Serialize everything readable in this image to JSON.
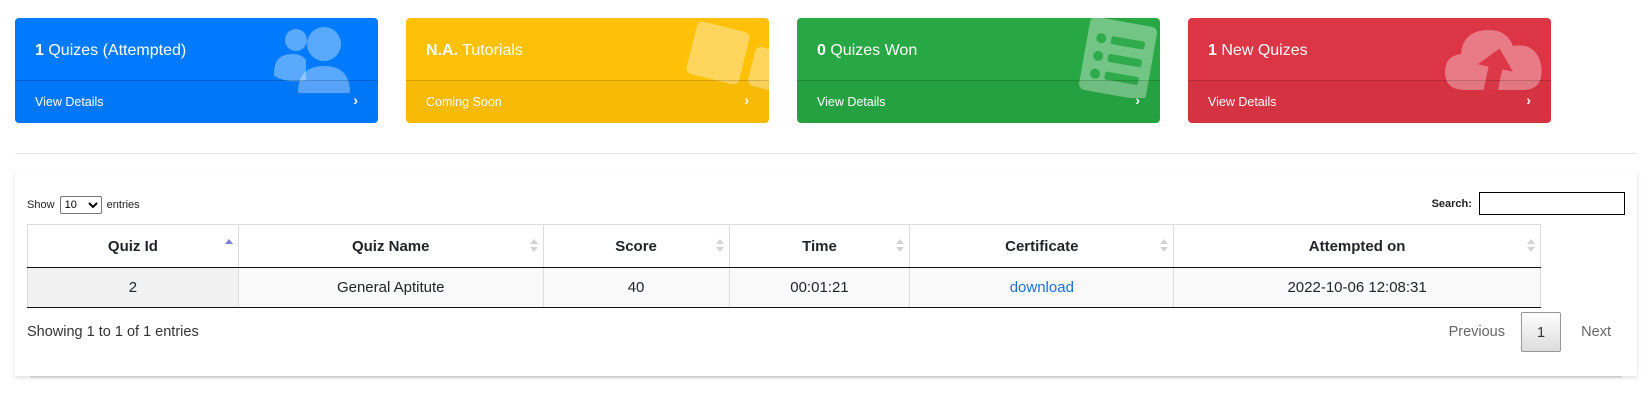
{
  "cards": [
    {
      "count": "1",
      "title": "Quizes (Attempted)",
      "link": "View Details",
      "color": "#007bff",
      "icon": "users-icon"
    },
    {
      "count": "N.A.",
      "title": "Tutorials",
      "link": "Coming Soon",
      "color": "#ffc107",
      "icon": "squares-icon"
    },
    {
      "count": "0",
      "title": "Quizes Won",
      "link": "View Details",
      "color": "#28a745",
      "icon": "list-icon"
    },
    {
      "count": "1",
      "title": "New Quizes",
      "link": "View Details",
      "color": "#dc3545",
      "icon": "cloud-upload-icon"
    }
  ],
  "table_controls": {
    "show_label": "Show",
    "entries_label": "entries",
    "length_value": "10",
    "search_label": "Search:",
    "search_value": ""
  },
  "table": {
    "headers": [
      "Quiz Id",
      "Quiz Name",
      "Score",
      "Time",
      "Certificate",
      "Attempted on"
    ],
    "rows": [
      {
        "quiz_id": "2",
        "quiz_name": "General Aptitute",
        "score": "40",
        "time": "00:01:21",
        "certificate": "download",
        "attempted_on": "2022-10-06 12:08:31"
      }
    ]
  },
  "footer": {
    "info": "Showing 1 to 1 of 1 entries",
    "previous": "Previous",
    "current_page": "1",
    "next": "Next"
  }
}
